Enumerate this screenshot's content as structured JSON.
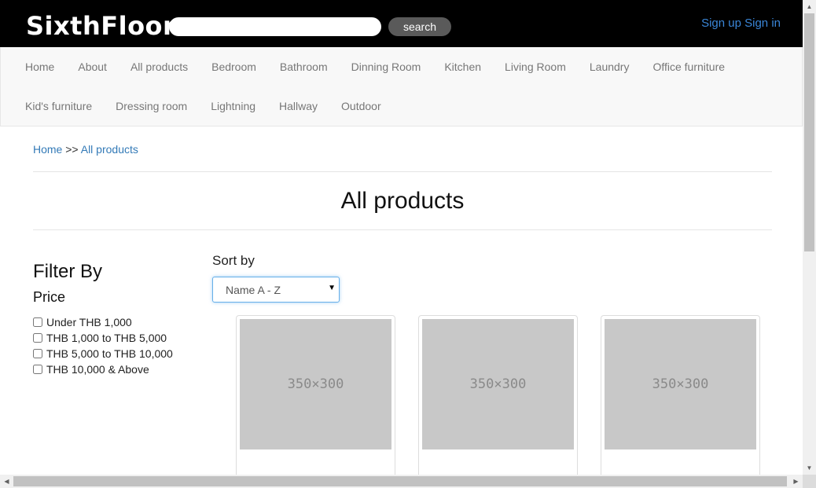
{
  "header": {
    "logo": "SixthFloor",
    "search_value": "",
    "search_button": "search",
    "signup": "Sign up",
    "signin": "Sign in"
  },
  "nav": {
    "row1": [
      "Home",
      "About",
      "All products",
      "Bedroom",
      "Bathroom",
      "Dinning Room",
      "Kitchen",
      "Living Room",
      "Laundry",
      "Office furniture"
    ],
    "row2": [
      "Kid's furniture",
      "Dressing room",
      "Lightning",
      "Hallway",
      "Outdoor"
    ]
  },
  "breadcrumb": {
    "home": "Home",
    "separator": ">>",
    "current": "All products"
  },
  "page_title": "All products",
  "filter": {
    "title": "Filter By",
    "price_title": "Price",
    "options": [
      "Under THB 1,000",
      "THB 1,000 to THB 5,000",
      "THB 5,000 to THB 10,000",
      "THB 10,000 & Above"
    ]
  },
  "sort": {
    "label": "Sort by",
    "selected": "Name A - Z"
  },
  "products": [
    {
      "placeholder": "350×300"
    },
    {
      "placeholder": "350×300"
    },
    {
      "placeholder": "350×300"
    }
  ],
  "colors": {
    "topbar": "#000000",
    "link": "#337ab7",
    "auth_link": "#3a86d8",
    "nav_bg": "#f8f8f8"
  }
}
